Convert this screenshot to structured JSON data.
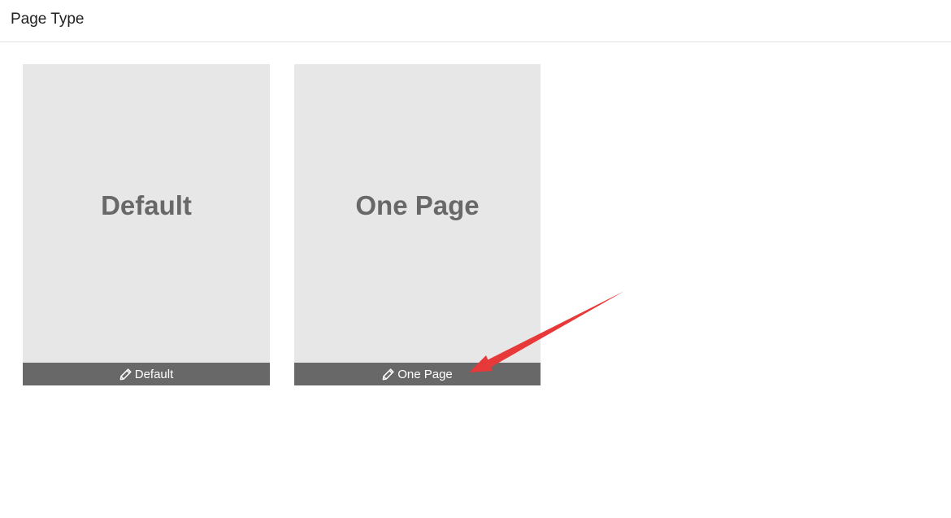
{
  "header": {
    "title": "Page Type"
  },
  "cards": [
    {
      "preview_text": "Default",
      "footer_label": "Default",
      "icon": "pencil-icon"
    },
    {
      "preview_text": "One Page",
      "footer_label": "One Page",
      "icon": "pencil-icon"
    }
  ],
  "colors": {
    "card_background": "#e7e7e7",
    "card_footer": "#686868",
    "preview_text": "#686868",
    "annotation_arrow": "#e8393a"
  }
}
